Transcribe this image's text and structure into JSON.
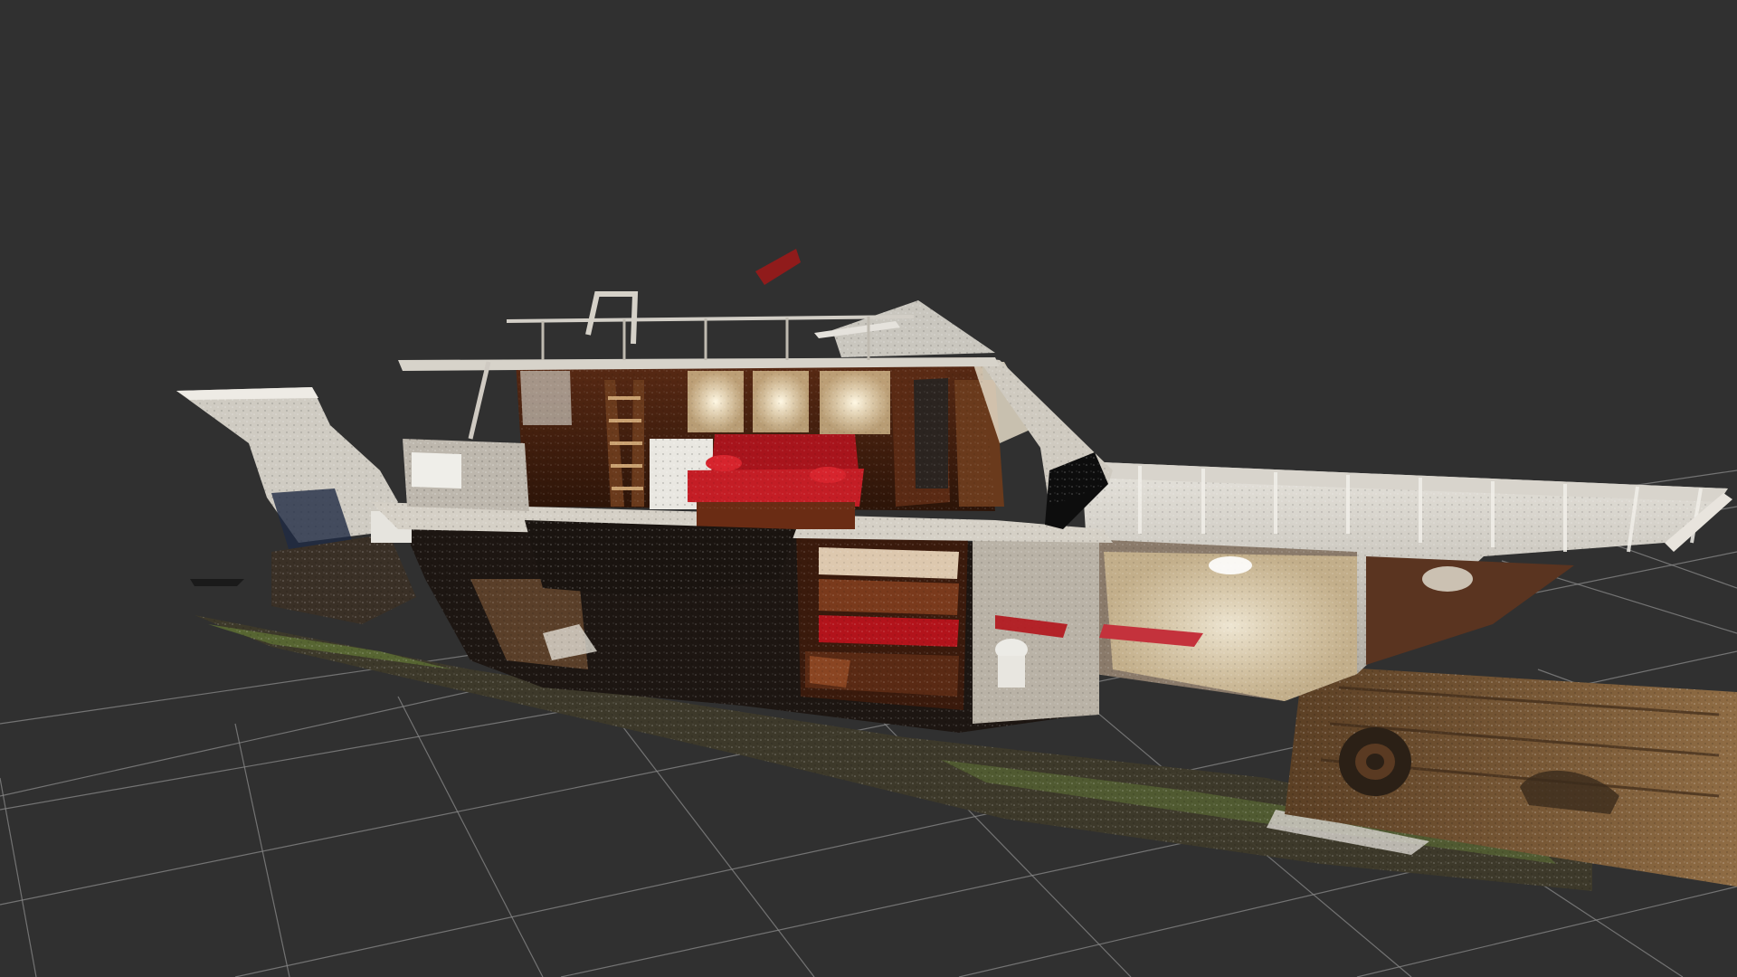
{
  "viewer": {
    "background_color": "#303030",
    "grid_line_color": "#8a8a8a",
    "grid": true
  },
  "scene": {
    "subject": "point-cloud-scan-boat-cutaway",
    "palette": {
      "hull_white": "#d9d6cf",
      "wood_dark": "#4a2412",
      "wood_mid": "#7a3a1c",
      "sofa_red": "#b3131b",
      "window_glow": "#f3e6c4",
      "wall_sand": "#7a5a38",
      "ground_grass": "#4d5a2c",
      "shadow": "#151210"
    }
  }
}
